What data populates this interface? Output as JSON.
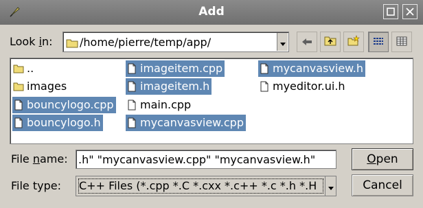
{
  "window": {
    "title": "Add"
  },
  "titlebar": {
    "icon": "app-feather-icon",
    "buttons": [
      "maximize-icon",
      "close-icon"
    ]
  },
  "lookin": {
    "label_prefix": "Look ",
    "label_underlined": "i",
    "label_suffix": "n:",
    "path": "/home/pierre/temp/app/",
    "tools": [
      "back-arrow-icon",
      "parent-folder-icon",
      "new-folder-icon",
      "list-view-icon",
      "detail-view-icon"
    ]
  },
  "files": {
    "items": [
      {
        "name": "..",
        "type": "folder",
        "selected": false
      },
      {
        "name": "images",
        "type": "folder",
        "selected": false
      },
      {
        "name": "bouncylogo.cpp",
        "type": "file",
        "selected": true
      },
      {
        "name": "bouncylogo.h",
        "type": "file",
        "selected": true
      },
      {
        "name": "imageitem.cpp",
        "type": "file",
        "selected": true
      },
      {
        "name": "imageitem.h",
        "type": "file",
        "selected": true
      },
      {
        "name": "main.cpp",
        "type": "file",
        "selected": false
      },
      {
        "name": "mycanvasview.cpp",
        "type": "file",
        "selected": true
      },
      {
        "name": "mycanvasview.h",
        "type": "file",
        "selected": true
      },
      {
        "name": "myeditor.ui.h",
        "type": "file",
        "selected": false
      }
    ]
  },
  "filename": {
    "label_prefix": "File ",
    "label_underlined": "n",
    "label_suffix": "ame:",
    "value": ".h\" \"mycanvasview.cpp\" \"mycanvasview.h\""
  },
  "filetype": {
    "label": "File type:",
    "value": "C++ Files (*.cpp *.C *.cxx *.c++ *.c *.h *.H"
  },
  "buttons": {
    "open_underlined": "O",
    "open_rest": "pen",
    "cancel": "Cancel"
  },
  "colors": {
    "selection": "#5f87b3",
    "titlebar": "#7a7a7a",
    "dialog_bg": "#d4d0c8"
  }
}
